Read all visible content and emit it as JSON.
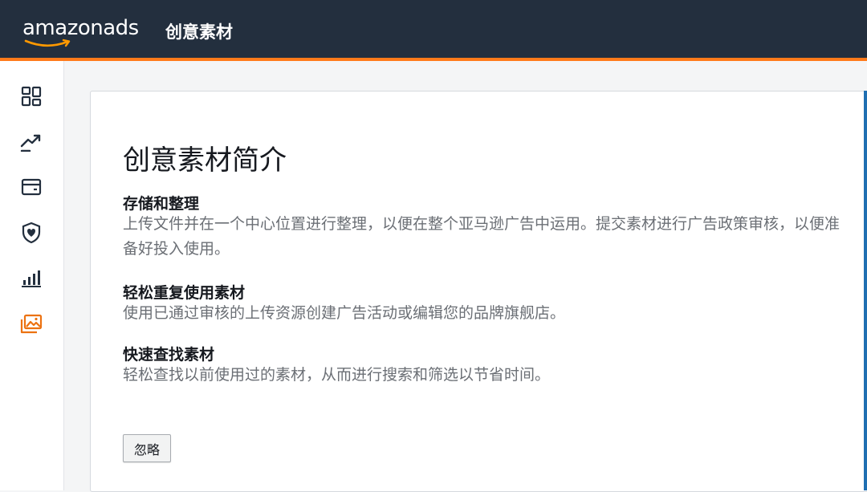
{
  "header": {
    "logo_main": "amazon",
    "logo_suffix": "ads",
    "app_title": "创意素材"
  },
  "sidebar": {
    "items": [
      {
        "icon": "dashboard-icon",
        "active": false
      },
      {
        "icon": "trend-up-icon",
        "active": false
      },
      {
        "icon": "wallet-icon",
        "active": false
      },
      {
        "icon": "shield-icon",
        "active": false
      },
      {
        "icon": "bar-chart-icon",
        "active": false
      },
      {
        "icon": "creative-assets-icon",
        "active": true
      }
    ]
  },
  "card": {
    "title": "创意素材简介",
    "sections": [
      {
        "heading": "存储和整理",
        "body": "上传文件并在一个中心位置进行整理，以便在整个亚马逊广告中运用。提交素材进行广告政策审核，以便准备好投入使用。"
      },
      {
        "heading": "轻松重复使用素材",
        "body": "使用已通过审核的上传资源创建广告活动或编辑您的品牌旗舰店。"
      },
      {
        "heading": "快速查找素材",
        "body": "轻松查找以前使用过的素材，从而进行搜索和筛选以节省时间。"
      }
    ],
    "dismiss_label": "忽略"
  },
  "colors": {
    "header_bg": "#232f3e",
    "accent_orange": "#ff7a1a",
    "icon_gray": "#232f3e",
    "active_icon": "#ec7211",
    "card_accent": "#1f6fb2"
  }
}
